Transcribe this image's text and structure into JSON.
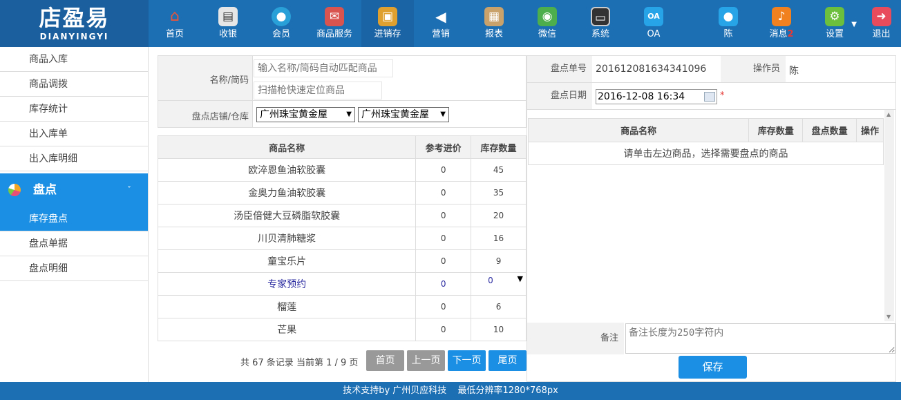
{
  "logo": {
    "cn": "店盈易",
    "en": "DIANYINGYI"
  },
  "nav": [
    {
      "label": "首页",
      "icon": "home-icon",
      "glyph": "⌂",
      "color": "#e8553a"
    },
    {
      "label": "收银",
      "icon": "cash-register-icon",
      "glyph": "▤",
      "color": "#555"
    },
    {
      "label": "会员",
      "icon": "member-icon",
      "glyph": "●",
      "color": "#2aa0d8"
    },
    {
      "label": "商品服务",
      "icon": "goods-service-icon",
      "glyph": "✉",
      "color": "#d9534f"
    },
    {
      "label": "进销存",
      "icon": "inventory-icon",
      "glyph": "▣",
      "color": "#e0a030"
    },
    {
      "label": "营销",
      "icon": "marketing-icon",
      "glyph": "◀",
      "color": "#2a8fd8"
    },
    {
      "label": "报表",
      "icon": "report-icon",
      "glyph": "▦",
      "color": "#8a6d3b"
    },
    {
      "label": "微信",
      "icon": "wechat-icon",
      "glyph": "◉",
      "color": "#4cae4c"
    },
    {
      "label": "系统",
      "icon": "system-icon",
      "glyph": "▭",
      "color": "#333"
    },
    {
      "label": "OA",
      "icon": "oa-icon",
      "glyph": "OA",
      "color": "#1a8fe3"
    }
  ],
  "user": {
    "name": "陈",
    "icon": "user-icon"
  },
  "messages": {
    "label": "消息",
    "count": "2",
    "icon": "bell-icon"
  },
  "settings": {
    "label": "设置",
    "icon": "gear-icon"
  },
  "logout": {
    "label": "退出",
    "icon": "logout-icon"
  },
  "sidebar": {
    "items": [
      "商品入库",
      "商品调拨",
      "库存统计",
      "出入库单",
      "出入库明细"
    ],
    "group": "盘点",
    "group_chevron": "ˇ",
    "subitems": [
      "库存盘点",
      "盘点单据",
      "盘点明细"
    ],
    "active_sub": "库存盘点"
  },
  "filter": {
    "name_label": "名称/简码",
    "name_placeholder": "输入名称/简码自动匹配商品",
    "scan_placeholder": "扫描枪快速定位商品",
    "store_label": "盘点店铺/仓库",
    "store_value": "广州珠宝黄金屋",
    "warehouse_value": "广州珠宝黄金屋"
  },
  "product_table": {
    "headers": [
      "商品名称",
      "参考进价",
      "库存数量"
    ],
    "rows": [
      {
        "name": "欧淬恩鱼油软胶囊",
        "price": "0",
        "stock": "45"
      },
      {
        "name": "金奥力鱼油软胶囊",
        "price": "0",
        "stock": "35"
      },
      {
        "name": "汤臣倍健大豆磷脂软胶囊",
        "price": "0",
        "stock": "20"
      },
      {
        "name": "川贝清肺糖浆",
        "price": "0",
        "stock": "16"
      },
      {
        "name": "童宝乐片",
        "price": "0",
        "stock": "9"
      },
      {
        "name": "专家预约",
        "price": "0",
        "stock": "0"
      },
      {
        "name": "榴莲",
        "price": "0",
        "stock": "6"
      },
      {
        "name": "芒果",
        "price": "0",
        "stock": "10"
      }
    ]
  },
  "pager": {
    "summary": "共 67 条记录 当前第 1 / 9 页",
    "first": "首页",
    "prev": "上一页",
    "next": "下一页",
    "last": "尾页"
  },
  "check_form": {
    "order_no_label": "盘点单号",
    "order_no": "201612081634341096",
    "operator_label": "操作员",
    "operator": "陈",
    "date_label": "盘点日期",
    "date": "2016-12-08 16:34",
    "required_mark": "*"
  },
  "check_table": {
    "headers": [
      "商品名称",
      "库存数量",
      "盘点数量",
      "操作"
    ],
    "empty_hint": "请单击左边商品，选择需要盘点的商品"
  },
  "remark": {
    "label": "备注",
    "placeholder": "备注长度为250字符内"
  },
  "save_label": "保存",
  "footer": {
    "support": "技术支持by 广州贝应科技",
    "resolution": "最低分辨率1280*768px"
  }
}
